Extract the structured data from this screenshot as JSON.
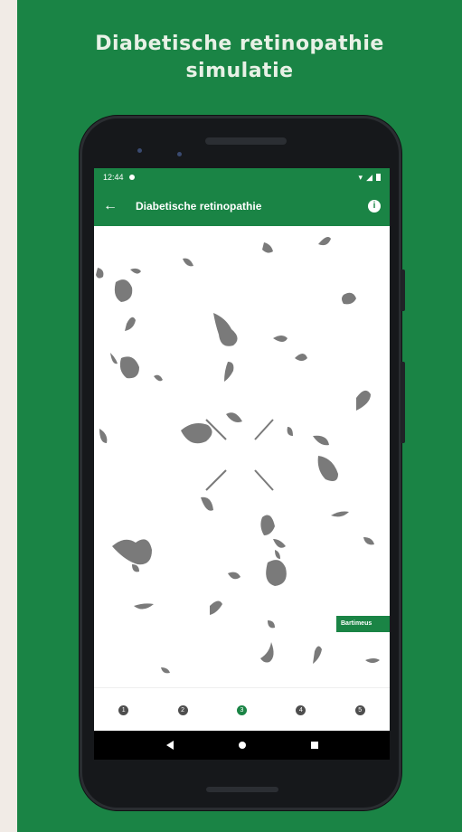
{
  "promo": {
    "title_line1": "Diabetische retinopathie",
    "title_line2": "simulatie"
  },
  "status_bar": {
    "time": "12:44"
  },
  "app_bar": {
    "title": "Diabetische retinopathie",
    "info": "i"
  },
  "side_label": "Bartimeus",
  "steps": [
    {
      "label": "1",
      "active": false
    },
    {
      "label": "2",
      "active": false
    },
    {
      "label": "3",
      "active": true
    },
    {
      "label": "4",
      "active": false
    },
    {
      "label": "5",
      "active": false
    }
  ],
  "colors": {
    "brand_green": "#1a8445",
    "spot_gray": "#7a7a7a",
    "background": "#f1ebe6"
  }
}
